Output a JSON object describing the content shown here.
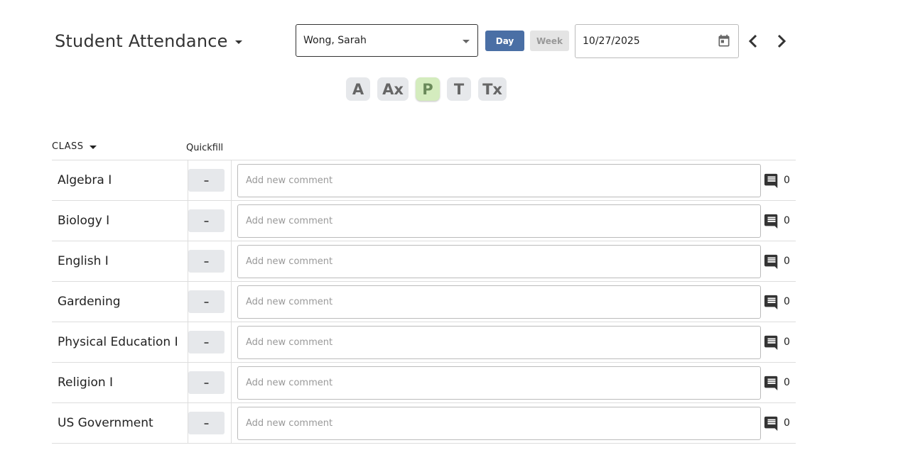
{
  "header": {
    "title": "Student Attendance",
    "student": "Wong, Sarah",
    "day_label": "Day",
    "week_label": "Week",
    "date": "10/27/2025"
  },
  "codes": [
    {
      "label": "A",
      "active": false
    },
    {
      "label": "Ax",
      "active": false
    },
    {
      "label": "P",
      "active": true
    },
    {
      "label": "T",
      "active": false
    },
    {
      "label": "Tx",
      "active": false
    }
  ],
  "table": {
    "class_header": "CLASS",
    "quickfill_header": "Quickfill",
    "comment_placeholder": "Add new comment",
    "rows": [
      {
        "name": "Algebra I",
        "quickfill": "–",
        "comments": "0"
      },
      {
        "name": "Biology I",
        "quickfill": "–",
        "comments": "0"
      },
      {
        "name": "English I",
        "quickfill": "–",
        "comments": "0"
      },
      {
        "name": "Gardening",
        "quickfill": "–",
        "comments": "0"
      },
      {
        "name": "Physical Education I",
        "quickfill": "–",
        "comments": "0"
      },
      {
        "name": "Religion I",
        "quickfill": "–",
        "comments": "0"
      },
      {
        "name": "US Government",
        "quickfill": "–",
        "comments": "0"
      }
    ]
  },
  "icons": {
    "calendar": "calendar-icon",
    "prev": "chevron-left-icon",
    "next": "chevron-right-icon",
    "comment": "comment-icon"
  },
  "colors": {
    "accent": "#4a6fa5",
    "present_active": "#d4ecbe",
    "code_bg": "#e6e8eb"
  }
}
